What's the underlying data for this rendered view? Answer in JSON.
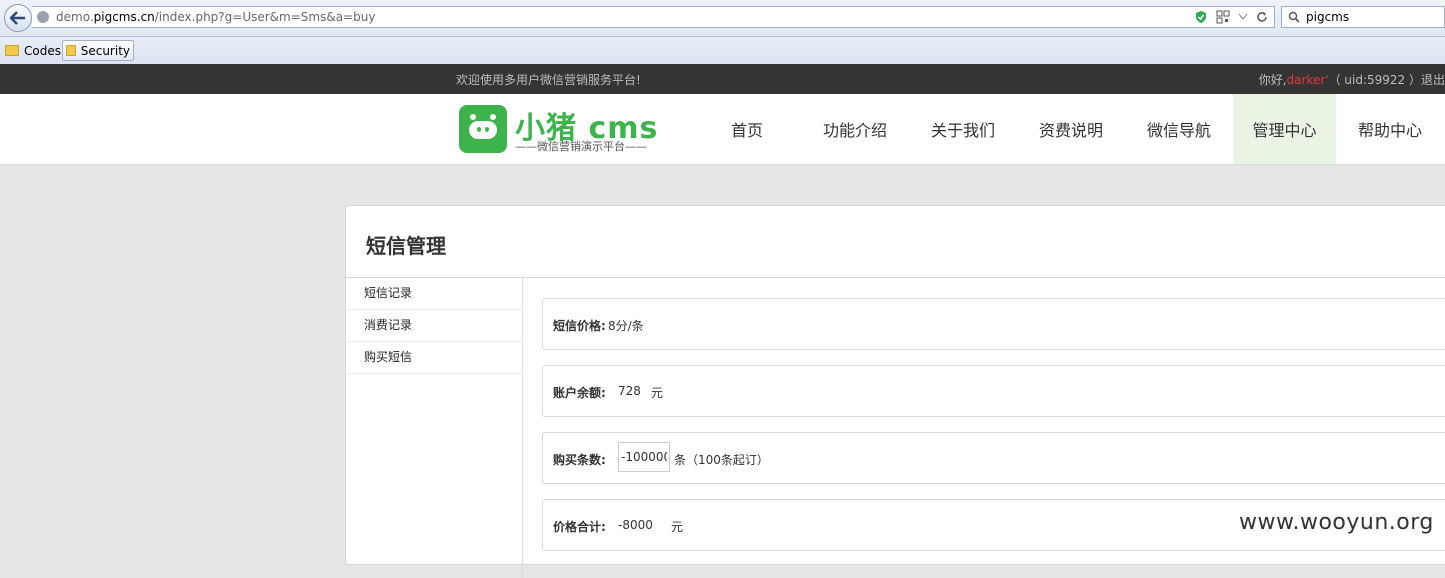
{
  "browser": {
    "url_prefix": "demo.",
    "url_domain": "pigcms.cn",
    "url_path": "/index.php?g=User&m=Sms&a=buy",
    "search_value": "pigcms",
    "bookmarks": [
      {
        "label": "Codes"
      },
      {
        "label": "Security"
      }
    ]
  },
  "topbar": {
    "welcome": "欢迎使用多用户微信营销服务平台!",
    "greeting": "你好,",
    "username": "darker'",
    "uid": "（ uid:59922 ）",
    "logout": "退出"
  },
  "logo": {
    "title": "小猪 cms",
    "subtitle": "——微信营销演示平台——"
  },
  "nav": [
    {
      "label": "首页"
    },
    {
      "label": "功能介绍"
    },
    {
      "label": "关于我们"
    },
    {
      "label": "资费说明"
    },
    {
      "label": "微信导航"
    },
    {
      "label": "管理中心"
    },
    {
      "label": "帮助中心"
    }
  ],
  "page": {
    "title": "短信管理",
    "sidebar": [
      {
        "label": "短信记录"
      },
      {
        "label": "消费记录"
      },
      {
        "label": "购买短信"
      }
    ],
    "price": {
      "label": "短信价格:",
      "value": "8分/条"
    },
    "balance": {
      "label": "账户余额:",
      "value": "728",
      "unit": "元"
    },
    "quantity": {
      "label": "购买条数:",
      "value": "-100000",
      "suffix": "条（100条起订）"
    },
    "total": {
      "label": "价格合计:",
      "value": "-8000",
      "unit": "元"
    }
  },
  "watermark": "www.wooyun.org",
  "colors": {
    "brand_green": "#3cb44b",
    "username_red": "#e53935",
    "topbar_bg": "#343434"
  }
}
